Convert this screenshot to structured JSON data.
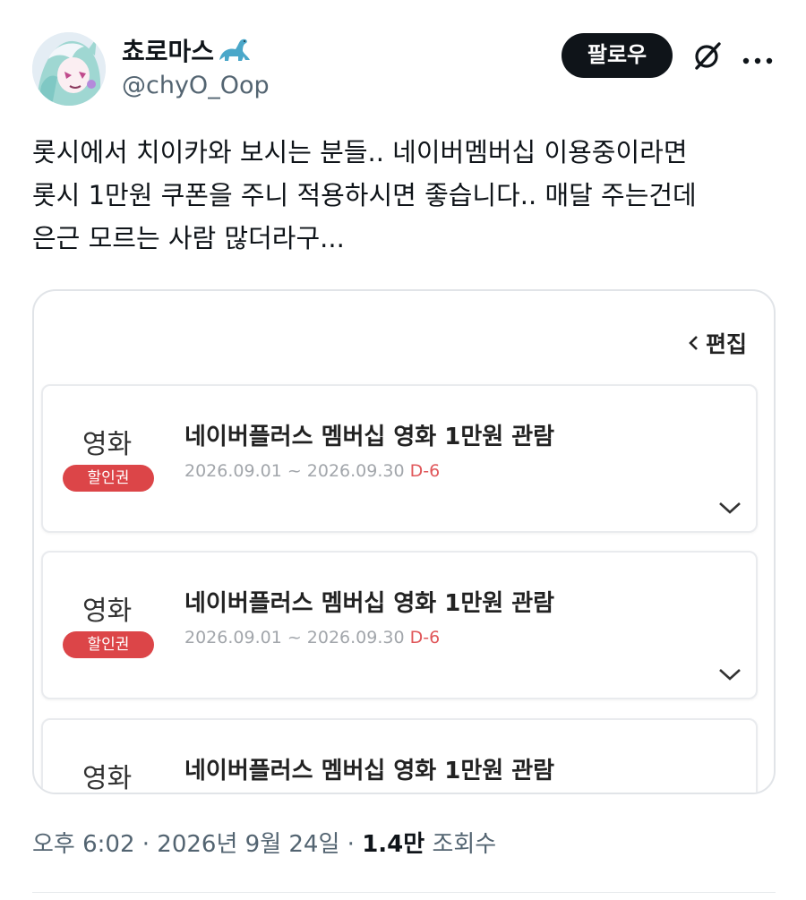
{
  "author": {
    "name": "쵸로마스",
    "handle": "@chyO_Oop"
  },
  "follow_label": "팔로우",
  "tweet": {
    "lines": [
      "롯시에서 치이카와 보시는 분들.. 네이버멤버십 이용중이라면",
      "롯시 1만원 쿠폰을 주니 적용하시면 좋습니다.. 매달 주는건데",
      "은근 모르는 사람 많더라구..."
    ]
  },
  "media": {
    "edit_label": "편집",
    "coupons": [
      {
        "category": "영화",
        "badge": "할인권",
        "title": "네이버플러스 멤버십 영화 1만원 관람",
        "period": "2026.09.01 ~ 2026.09.30",
        "dday": "D-6"
      },
      {
        "category": "영화",
        "badge": "할인권",
        "title": "네이버플러스 멤버십 영화 1만원 관람",
        "period": "2026.09.01 ~ 2026.09.30",
        "dday": "D-6"
      },
      {
        "category": "영화",
        "title": "네이버플러스 멤버십 영화 1만원 관람"
      }
    ]
  },
  "meta": {
    "time": "오후 6:02",
    "date": "2026년 9월 24일",
    "views_count": "1.4만",
    "views_label": "조회수"
  },
  "colors": {
    "follow_button": "#0f1419",
    "badge": "#dc4548",
    "dday": "#e0575a",
    "secondary_text": "#536471"
  }
}
